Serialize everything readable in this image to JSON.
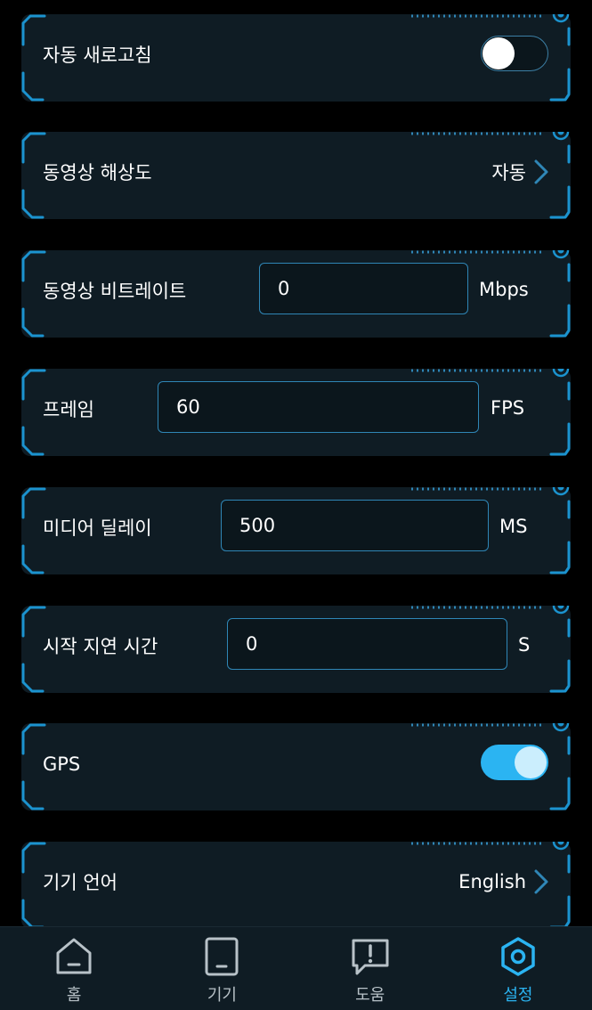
{
  "colors": {
    "background": "#000000",
    "card": "#0f1c24",
    "accent": "#2bb4f2",
    "frame": "#1b93cf",
    "input_border": "#2f86b6",
    "text": "#ffffff",
    "tab_inactive": "#b8c2c8"
  },
  "settings": {
    "auto_refresh": {
      "label": "자동 새로고침",
      "enabled": false
    },
    "video_resolution": {
      "label": "동영상 해상도",
      "value": "자동"
    },
    "video_bitrate": {
      "label": "동영상 비트레이트",
      "value": "0",
      "unit": "Mbps"
    },
    "frame": {
      "label": "프레임",
      "value": "60",
      "unit": "FPS"
    },
    "media_delay": {
      "label": "미디어 딜레이",
      "value": "500",
      "unit": "MS"
    },
    "start_delay": {
      "label": "시작 지연 시간",
      "value": "0",
      "unit": "S"
    },
    "gps": {
      "label": "GPS",
      "enabled": true
    },
    "device_language": {
      "label": "기기 언어",
      "value": "English"
    }
  },
  "tabbar": {
    "items": [
      {
        "label": "홈",
        "icon": "home-icon",
        "active": false
      },
      {
        "label": "기기",
        "icon": "device-icon",
        "active": false
      },
      {
        "label": "도움",
        "icon": "help-icon",
        "active": false
      },
      {
        "label": "설정",
        "icon": "settings-icon",
        "active": true
      }
    ]
  }
}
